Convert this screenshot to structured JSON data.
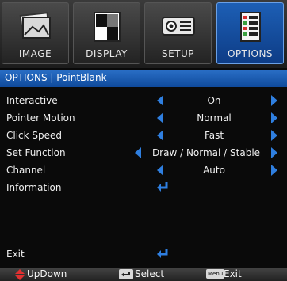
{
  "tabs": [
    {
      "label": "IMAGE",
      "icon": "image-icon",
      "active": false
    },
    {
      "label": "DISPLAY",
      "icon": "display-icon",
      "active": false
    },
    {
      "label": "SETUP",
      "icon": "setup-icon",
      "active": false
    },
    {
      "label": "OPTIONS",
      "icon": "options-icon",
      "active": true
    }
  ],
  "title": "OPTIONS | PointBlank",
  "rows": [
    {
      "label": "Interactive",
      "value": "On"
    },
    {
      "label": "Pointer Motion",
      "value": "Normal"
    },
    {
      "label": "Click Speed",
      "value": "Fast"
    },
    {
      "label": "Set Function",
      "value": "Draw / Normal / Stable"
    },
    {
      "label": "Channel",
      "value": "Auto"
    },
    {
      "label": "Information",
      "value": ""
    }
  ],
  "exit": {
    "label": "Exit"
  },
  "footer": {
    "updown": "UpDown",
    "select": "Select",
    "exit": "Exit",
    "menu_key": "Menu"
  },
  "colors": {
    "accent": "#2f7fe0",
    "title_bar": "#1f5fb5",
    "updown_icon": "#e03030"
  }
}
